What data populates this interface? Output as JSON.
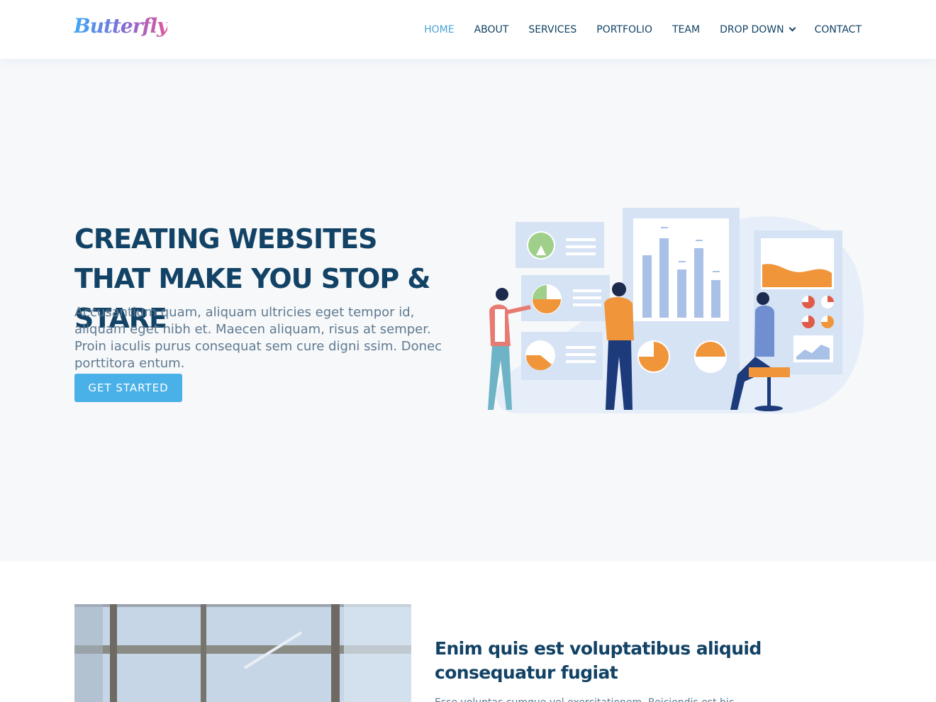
{
  "brand": {
    "logo_text": "Butterfly"
  },
  "nav": {
    "items": [
      {
        "label": "HOME",
        "active": true
      },
      {
        "label": "ABOUT",
        "active": false
      },
      {
        "label": "SERVICES",
        "active": false
      },
      {
        "label": "PORTFOLIO",
        "active": false
      },
      {
        "label": "TEAM",
        "active": false
      },
      {
        "label": "DROP DOWN",
        "active": false,
        "icon": "chevron-down-icon"
      },
      {
        "label": "CONTACT",
        "active": false
      }
    ]
  },
  "hero": {
    "title": "CREATING WEBSITES THAT MAKE YOU STOP & STARE",
    "description": "Accusantium quam, aliquam ultricies eget tempor id, aliquam eget nibh et. Maecen aliquam, risus at semper. Proin iaculis purus consequat sem cure digni ssim. Donec porttitora entum.",
    "cta_label": "GET STARTED"
  },
  "about": {
    "title": "Enim quis est voluptatibus aliquid consequatur fugiat",
    "text": "Esse voluptas cumque vel exercitationem. Reiciendis est hic"
  },
  "colors": {
    "primary": "#124265",
    "accent": "#4ab0e8",
    "hero_bg": "#f7f8f9",
    "illustration_orange": "#f0953a",
    "illustration_blue": "#a9c1e6"
  }
}
